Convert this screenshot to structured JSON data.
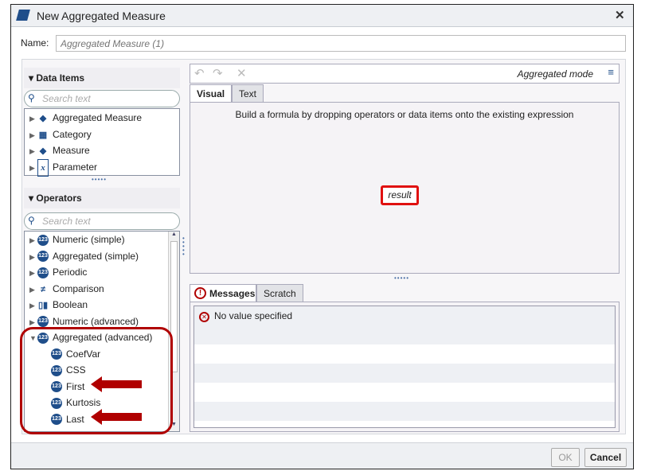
{
  "dialog": {
    "title": "New Aggregated Measure",
    "close_icon": "close-icon"
  },
  "name": {
    "label": "Name:",
    "placeholder": "Aggregated Measure (1)"
  },
  "data_items": {
    "header": "Data Items",
    "search_placeholder": "Search text",
    "items": [
      {
        "label": "Aggregated Measure",
        "icon": "aggregated-measure-icon"
      },
      {
        "label": "Category",
        "icon": "category-icon"
      },
      {
        "label": "Measure",
        "icon": "measure-icon"
      },
      {
        "label": "Parameter",
        "icon": "parameter-icon"
      }
    ]
  },
  "operators": {
    "header": "Operators",
    "search_placeholder": "Search text",
    "groups": [
      {
        "label": "Numeric (simple)"
      },
      {
        "label": "Aggregated (simple)"
      },
      {
        "label": "Periodic"
      },
      {
        "label": "Comparison"
      },
      {
        "label": "Boolean"
      },
      {
        "label": "Numeric (advanced)"
      },
      {
        "label": "Aggregated (advanced)",
        "expanded": true
      }
    ],
    "children": [
      {
        "label": "CoefVar"
      },
      {
        "label": "CSS"
      },
      {
        "label": "First"
      },
      {
        "label": "Kurtosis"
      },
      {
        "label": "Last"
      }
    ]
  },
  "editor": {
    "mode": "Aggregated mode",
    "tabs": [
      "Visual",
      "Text"
    ],
    "active_tab": "Visual",
    "hint": "Build a formula by dropping operators or data items onto the existing expression",
    "result": "result"
  },
  "messages": {
    "tabs": [
      "Messages",
      "Scratch"
    ],
    "active_tab": "Messages",
    "items": [
      "No value specified"
    ]
  },
  "footer": {
    "ok": "OK",
    "cancel": "Cancel"
  },
  "colors": {
    "annotation": "#b00000",
    "brand": "#1f4e8a"
  }
}
